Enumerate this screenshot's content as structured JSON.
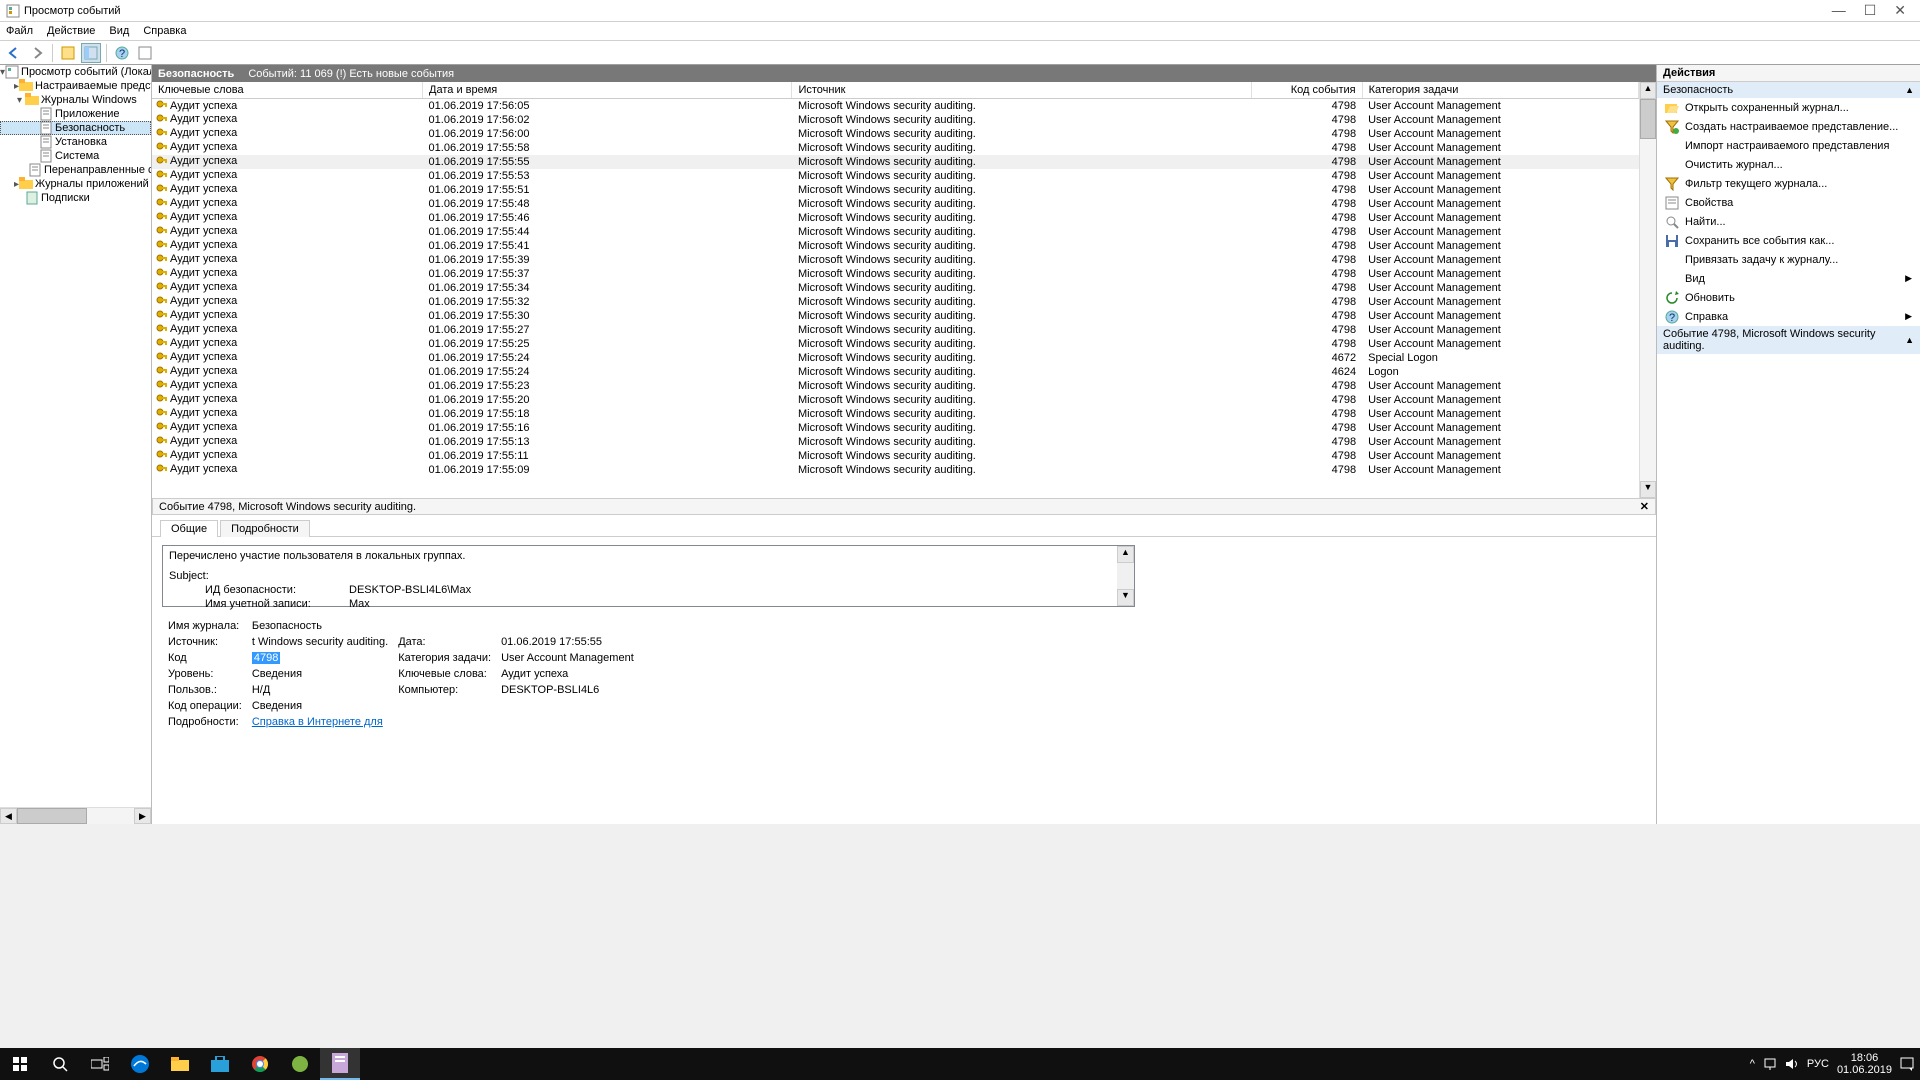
{
  "window": {
    "title": "Просмотр событий"
  },
  "menubar": [
    "Файл",
    "Действие",
    "Вид",
    "Справка"
  ],
  "nav": [
    {
      "depth": 0,
      "exp": "▾",
      "icon": "event-viewer",
      "label": "Просмотр событий (Локальн"
    },
    {
      "depth": 1,
      "exp": "▸",
      "icon": "folder",
      "label": "Настраиваемые представле"
    },
    {
      "depth": 1,
      "exp": "▾",
      "icon": "folder",
      "label": "Журналы Windows"
    },
    {
      "depth": 2,
      "exp": "",
      "icon": "log",
      "label": "Приложение"
    },
    {
      "depth": 2,
      "exp": "",
      "icon": "log",
      "label": "Безопасность",
      "selected": true
    },
    {
      "depth": 2,
      "exp": "",
      "icon": "log",
      "label": "Установка"
    },
    {
      "depth": 2,
      "exp": "",
      "icon": "log",
      "label": "Система"
    },
    {
      "depth": 2,
      "exp": "",
      "icon": "log",
      "label": "Перенаправленные соб"
    },
    {
      "depth": 1,
      "exp": "▸",
      "icon": "folder",
      "label": "Журналы приложений и сл"
    },
    {
      "depth": 1,
      "exp": "",
      "icon": "subs",
      "label": "Подписки"
    }
  ],
  "category": {
    "name": "Безопасность",
    "summary": "Событий: 11 069 (!) Есть новые события"
  },
  "columns": [
    "Ключевые слова",
    "Дата и время",
    "Источник",
    "Код события",
    "Категория задачи"
  ],
  "rows": [
    {
      "kw": "Аудит успеха",
      "dt": "01.06.2019 17:56:05",
      "src": "Microsoft Windows security auditing.",
      "id": "4798",
      "cat": "User Account Management"
    },
    {
      "kw": "Аудит успеха",
      "dt": "01.06.2019 17:56:02",
      "src": "Microsoft Windows security auditing.",
      "id": "4798",
      "cat": "User Account Management"
    },
    {
      "kw": "Аудит успеха",
      "dt": "01.06.2019 17:56:00",
      "src": "Microsoft Windows security auditing.",
      "id": "4798",
      "cat": "User Account Management"
    },
    {
      "kw": "Аудит успеха",
      "dt": "01.06.2019 17:55:58",
      "src": "Microsoft Windows security auditing.",
      "id": "4798",
      "cat": "User Account Management"
    },
    {
      "kw": "Аудит успеха",
      "dt": "01.06.2019 17:55:55",
      "src": "Microsoft Windows security auditing.",
      "id": "4798",
      "cat": "User Account Management",
      "selected": true
    },
    {
      "kw": "Аудит успеха",
      "dt": "01.06.2019 17:55:53",
      "src": "Microsoft Windows security auditing.",
      "id": "4798",
      "cat": "User Account Management"
    },
    {
      "kw": "Аудит успеха",
      "dt": "01.06.2019 17:55:51",
      "src": "Microsoft Windows security auditing.",
      "id": "4798",
      "cat": "User Account Management"
    },
    {
      "kw": "Аудит успеха",
      "dt": "01.06.2019 17:55:48",
      "src": "Microsoft Windows security auditing.",
      "id": "4798",
      "cat": "User Account Management"
    },
    {
      "kw": "Аудит успеха",
      "dt": "01.06.2019 17:55:46",
      "src": "Microsoft Windows security auditing.",
      "id": "4798",
      "cat": "User Account Management"
    },
    {
      "kw": "Аудит успеха",
      "dt": "01.06.2019 17:55:44",
      "src": "Microsoft Windows security auditing.",
      "id": "4798",
      "cat": "User Account Management"
    },
    {
      "kw": "Аудит успеха",
      "dt": "01.06.2019 17:55:41",
      "src": "Microsoft Windows security auditing.",
      "id": "4798",
      "cat": "User Account Management"
    },
    {
      "kw": "Аудит успеха",
      "dt": "01.06.2019 17:55:39",
      "src": "Microsoft Windows security auditing.",
      "id": "4798",
      "cat": "User Account Management"
    },
    {
      "kw": "Аудит успеха",
      "dt": "01.06.2019 17:55:37",
      "src": "Microsoft Windows security auditing.",
      "id": "4798",
      "cat": "User Account Management"
    },
    {
      "kw": "Аудит успеха",
      "dt": "01.06.2019 17:55:34",
      "src": "Microsoft Windows security auditing.",
      "id": "4798",
      "cat": "User Account Management"
    },
    {
      "kw": "Аудит успеха",
      "dt": "01.06.2019 17:55:32",
      "src": "Microsoft Windows security auditing.",
      "id": "4798",
      "cat": "User Account Management"
    },
    {
      "kw": "Аудит успеха",
      "dt": "01.06.2019 17:55:30",
      "src": "Microsoft Windows security auditing.",
      "id": "4798",
      "cat": "User Account Management"
    },
    {
      "kw": "Аудит успеха",
      "dt": "01.06.2019 17:55:27",
      "src": "Microsoft Windows security auditing.",
      "id": "4798",
      "cat": "User Account Management"
    },
    {
      "kw": "Аудит успеха",
      "dt": "01.06.2019 17:55:25",
      "src": "Microsoft Windows security auditing.",
      "id": "4798",
      "cat": "User Account Management"
    },
    {
      "kw": "Аудит успеха",
      "dt": "01.06.2019 17:55:24",
      "src": "Microsoft Windows security auditing.",
      "id": "4672",
      "cat": "Special Logon"
    },
    {
      "kw": "Аудит успеха",
      "dt": "01.06.2019 17:55:24",
      "src": "Microsoft Windows security auditing.",
      "id": "4624",
      "cat": "Logon"
    },
    {
      "kw": "Аудит успеха",
      "dt": "01.06.2019 17:55:23",
      "src": "Microsoft Windows security auditing.",
      "id": "4798",
      "cat": "User Account Management"
    },
    {
      "kw": "Аудит успеха",
      "dt": "01.06.2019 17:55:20",
      "src": "Microsoft Windows security auditing.",
      "id": "4798",
      "cat": "User Account Management"
    },
    {
      "kw": "Аудит успеха",
      "dt": "01.06.2019 17:55:18",
      "src": "Microsoft Windows security auditing.",
      "id": "4798",
      "cat": "User Account Management"
    },
    {
      "kw": "Аудит успеха",
      "dt": "01.06.2019 17:55:16",
      "src": "Microsoft Windows security auditing.",
      "id": "4798",
      "cat": "User Account Management"
    },
    {
      "kw": "Аудит успеха",
      "dt": "01.06.2019 17:55:13",
      "src": "Microsoft Windows security auditing.",
      "id": "4798",
      "cat": "User Account Management"
    },
    {
      "kw": "Аудит успеха",
      "dt": "01.06.2019 17:55:11",
      "src": "Microsoft Windows security auditing.",
      "id": "4798",
      "cat": "User Account Management"
    },
    {
      "kw": "Аудит успеха",
      "dt": "01.06.2019 17:55:09",
      "src": "Microsoft Windows security auditing.",
      "id": "4798",
      "cat": "User Account Management"
    }
  ],
  "detail": {
    "header": "Событие 4798, Microsoft Windows security auditing.",
    "tabs": [
      "Общие",
      "Подробности"
    ],
    "message_line1": "Перечислено участие пользователя в локальных группах.",
    "subject": "Subject:",
    "sid_label": "ИД безопасности:",
    "sid_val": "DESKTOP-BSLI4L6\\Max",
    "acct_label": "Имя учетной записи:",
    "acct_val": "Max",
    "log_name_label": "Имя журнала:",
    "log_name_val": "Безопасность",
    "source_label": "Источник:",
    "source_val": "t Windows security auditing.",
    "date_label": "Дата:",
    "date_val": "01.06.2019 17:55:55",
    "code_label": "Код",
    "code_val": "4798",
    "taskcat_label": "Категория задачи:",
    "taskcat_val": "User Account Management",
    "level_label": "Уровень:",
    "level_val": "Сведения",
    "kw_label": "Ключевые слова:",
    "kw_val": "Аудит успеха",
    "user_label": "Пользов.:",
    "user_val": "Н/Д",
    "computer_label": "Компьютер:",
    "computer_val": "DESKTOP-BSLI4L6",
    "opcode_label": "Код операции:",
    "opcode_val": "Сведения",
    "moreinfo_label": "Подробности:",
    "moreinfo_link": "Справка в Интернете для "
  },
  "actions": {
    "header": "Действия",
    "section1": "Безопасность",
    "items1": [
      {
        "icon": "open",
        "label": "Открыть сохраненный журнал..."
      },
      {
        "icon": "filter-new",
        "label": "Создать настраиваемое представление..."
      },
      {
        "icon": "",
        "label": "Импорт настраиваемого представления"
      },
      {
        "icon": "",
        "label": "Очистить журнал..."
      },
      {
        "icon": "filter",
        "label": "Фильтр текущего журнала..."
      },
      {
        "icon": "props",
        "label": "Свойства"
      },
      {
        "icon": "find",
        "label": "Найти..."
      },
      {
        "icon": "save",
        "label": "Сохранить все события как..."
      },
      {
        "icon": "",
        "label": "Привязать задачу к журналу..."
      },
      {
        "icon": "",
        "label": "Вид",
        "arrow": true
      },
      {
        "icon": "refresh",
        "label": "Обновить"
      },
      {
        "icon": "help",
        "label": "Справка",
        "arrow": true
      }
    ],
    "section2": "Событие 4798, Microsoft Windows security auditing."
  },
  "tray": {
    "lang": "РУС",
    "time": "18:06",
    "date": "01.06.2019"
  }
}
